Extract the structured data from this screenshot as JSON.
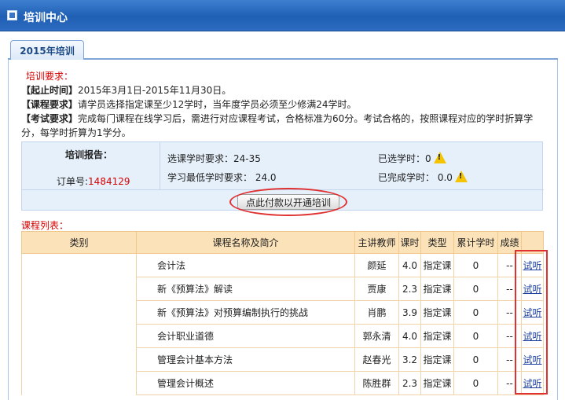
{
  "window": {
    "title": "培训中心"
  },
  "tabs": [
    {
      "label": "2015年培训"
    }
  ],
  "requirements": {
    "title": "培训要求：",
    "deadline_label": "【起止时间】",
    "deadline_text": "2015年3月1日-2015年11月30日。",
    "course_label": "【课程要求】",
    "course_text": "请学员选择指定课至少12学时，当年度学员必须至少修满24学时。",
    "exam_label": "【考试要求】",
    "exam_text_1": "完成每门课程在线学习后，需进行对应课程考试，合格标准为60分。考试合格的，按照课程对应的学时折算学",
    "exam_text_2": "分，每学时折算为1学分。"
  },
  "report": {
    "title": "培训报告：",
    "order_label": "订单号:",
    "order_number": "1484129",
    "selected_req_label": "选课学时要求：24-35",
    "selected_label": "已选学时：0",
    "min_req_label": "学习最低学时要求：  24.0",
    "completed_label": "已完成学时：  0.0",
    "pay_button": "点此付款以开通培训"
  },
  "course_list": {
    "title": "课程列表：",
    "headers": [
      "类别",
      "课程名称及简介",
      "主讲教师",
      "课时",
      "类型",
      "累计学时",
      "成绩",
      ""
    ],
    "rows": [
      {
        "name": "会计法",
        "teacher": "颜延",
        "hours": "4.0",
        "type": "指定课",
        "accum": "0",
        "score": "--",
        "action": "试听"
      },
      {
        "name": "新《预算法》解读",
        "teacher": "贾康",
        "hours": "2.3",
        "type": "指定课",
        "accum": "0",
        "score": "--",
        "action": "试听"
      },
      {
        "name": "新《预算法》对预算编制执行的挑战",
        "teacher": "肖鹏",
        "hours": "3.9",
        "type": "指定课",
        "accum": "0",
        "score": "--",
        "action": "试听"
      },
      {
        "name": "会计职业道德",
        "teacher": "郭永清",
        "hours": "4.0",
        "type": "指定课",
        "accum": "0",
        "score": "--",
        "action": "试听"
      },
      {
        "name": "管理会计基本方法",
        "teacher": "赵春光",
        "hours": "3.2",
        "type": "指定课",
        "accum": "0",
        "score": "--",
        "action": "试听"
      },
      {
        "name": "管理会计概述",
        "teacher": "陈胜群",
        "hours": "2.3",
        "type": "指定课",
        "accum": "0",
        "score": "--",
        "action": "试听"
      }
    ]
  },
  "colors": {
    "accent_red": "#d40000",
    "title_blue": "#1f5fb4",
    "header_orange": "#fbe2b8",
    "link_blue": "#1a3fa0"
  },
  "icons": {
    "warning": "warning-icon",
    "window": "window-icon"
  }
}
